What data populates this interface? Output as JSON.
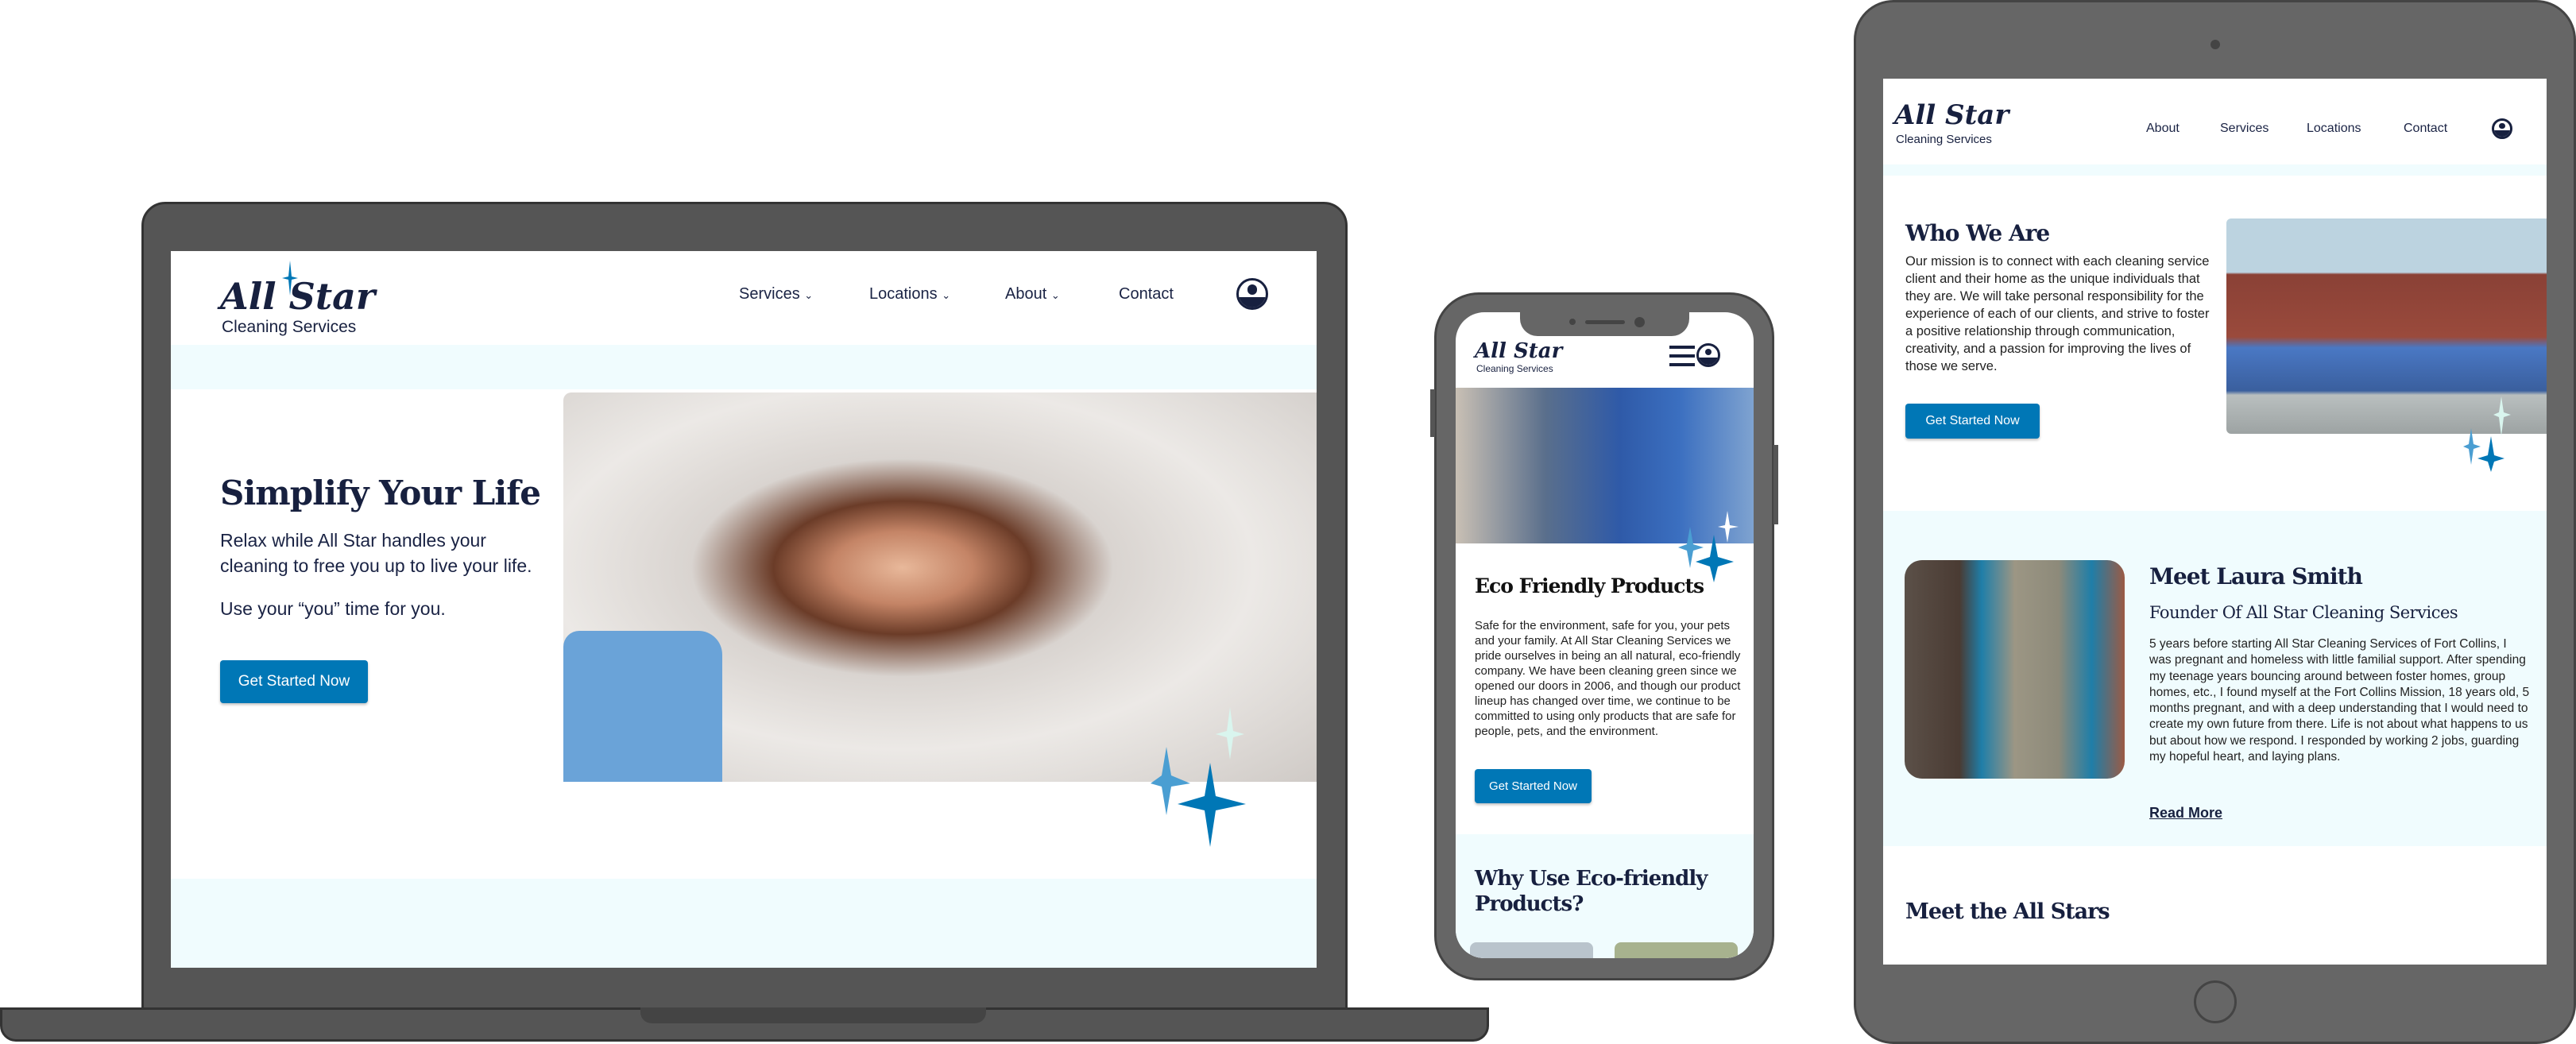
{
  "brand": {
    "name": "All Star",
    "tagline": "Cleaning Services"
  },
  "colors": {
    "navy": "#17203f",
    "accent": "#0077b6",
    "light_band": "#f0fcfe",
    "device_frame": "#5a5a5a"
  },
  "laptop": {
    "nav": [
      {
        "label": "Services",
        "has_dropdown": true
      },
      {
        "label": "Locations",
        "has_dropdown": true
      },
      {
        "label": "About",
        "has_dropdown": true
      },
      {
        "label": "Contact",
        "has_dropdown": false
      }
    ],
    "account_icon": "user-circle-icon",
    "hero": {
      "title": "Simplify Your Life",
      "text1": "Relax while All Star handles your cleaning to free you up to live your life.",
      "text2": "Use your “you” time for you.",
      "cta": "Get Started Now"
    }
  },
  "phone": {
    "menu_icon": "hamburger-icon",
    "account_icon": "user-circle-icon",
    "eco": {
      "title": "Eco Friendly Products",
      "text": "Safe for the environment, safe for you, your pets and your family. At All Star Cleaning Services we pride ourselves in being an all natural, eco-friendly company. We have been cleaning green since we opened our doors in 2006, and though our product lineup has changed over time, we continue to be committed to using only products that are safe for people, pets, and the environment.",
      "cta": "Get Started Now"
    },
    "why_title": "Why Use Eco-friendly Products?"
  },
  "tablet": {
    "nav": [
      {
        "label": "About"
      },
      {
        "label": "Services"
      },
      {
        "label": "Locations"
      },
      {
        "label": "Contact"
      }
    ],
    "account_icon": "user-circle-icon",
    "who": {
      "title": "Who We Are",
      "text": "Our mission is to connect with each cleaning service client and their home as the unique individuals that they are. We will take personal responsibility for the experience of each of our clients, and strive to foster a positive relationship through communication, creativity, and a passion for improving the lives of those we serve.",
      "cta": "Get Started Now"
    },
    "founder": {
      "title": "Meet Laura Smith",
      "subtitle": "Founder Of All Star Cleaning Services",
      "text": "5 years before starting All Star Cleaning Services of Fort Collins, I was pregnant and homeless with little familial support. After spending my teenage years bouncing around between foster homes, group homes, etc., I found myself at the Fort Collins Mission, 18 years old, 5 months pregnant, and with a deep understanding that I would need to create my own future from there. Life is not about what happens to us but about how we respond. I responded by working 2 jobs, guarding my hopeful heart, and laying plans.",
      "read_more": "Read More"
    },
    "team_title": "Meet the All Stars"
  }
}
